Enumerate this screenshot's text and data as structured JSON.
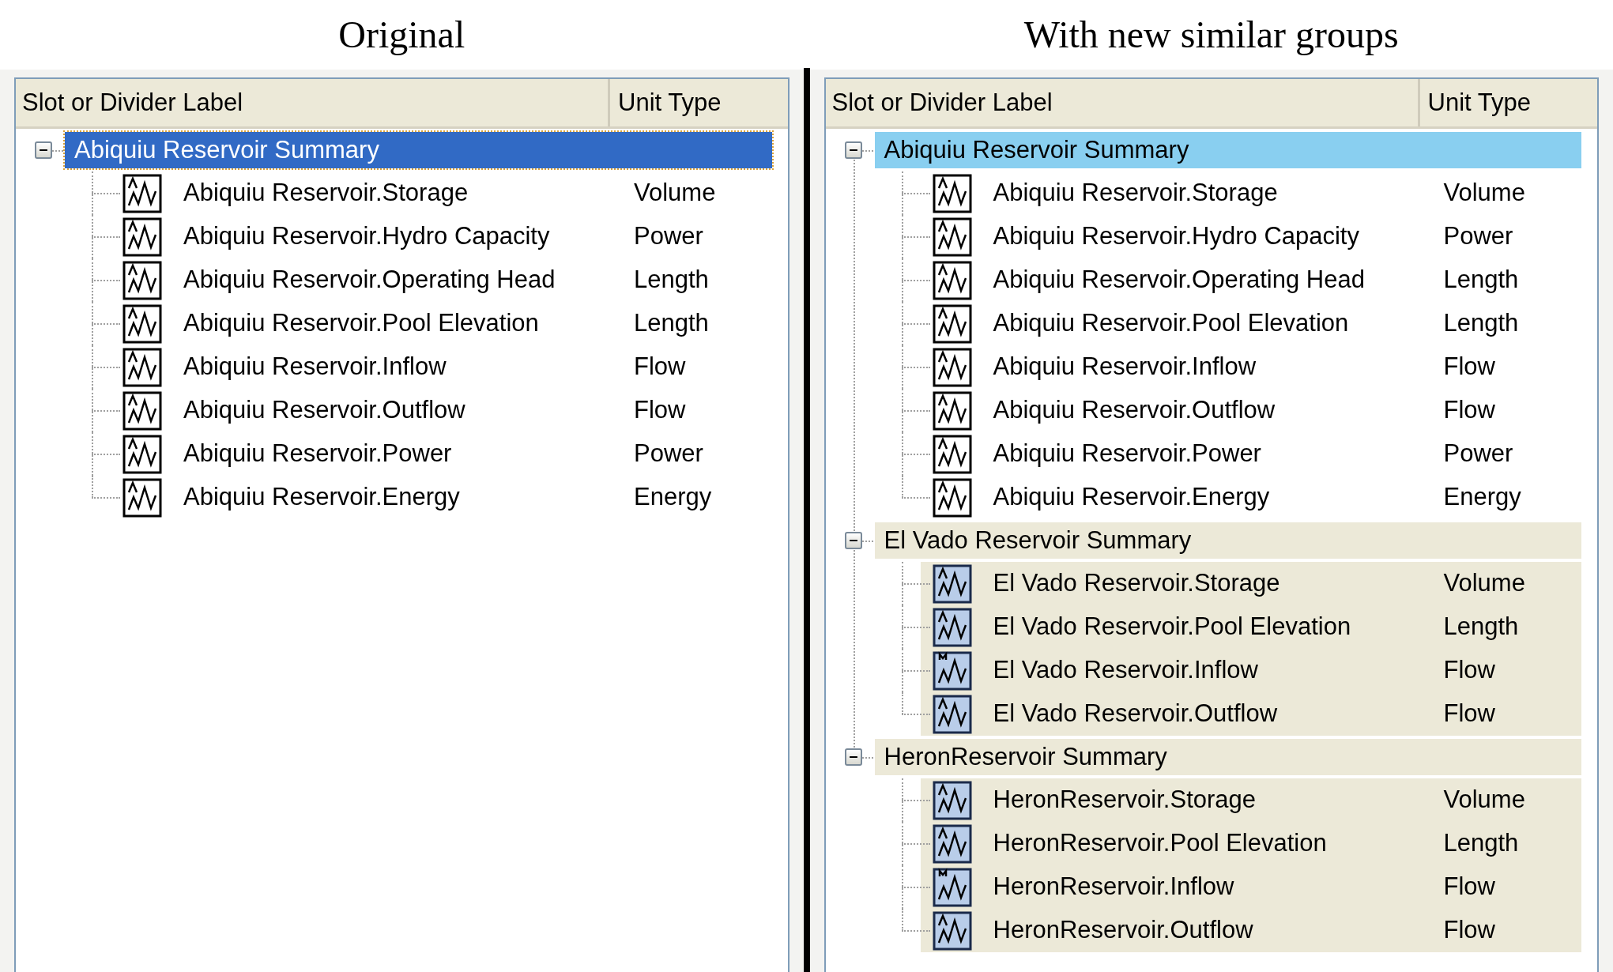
{
  "panels": [
    {
      "caption": "Original",
      "columns": [
        "Slot or Divider Label",
        "Unit Type"
      ],
      "groups": [
        {
          "label": "Abiquiu Reservoir Summary",
          "kind": "selected",
          "expanded": true,
          "children": [
            {
              "label": "Abiquiu Reservoir.Storage",
              "unit": "Volume"
            },
            {
              "label": "Abiquiu Reservoir.Hydro Capacity",
              "unit": "Power"
            },
            {
              "label": "Abiquiu Reservoir.Operating Head",
              "unit": "Length"
            },
            {
              "label": "Abiquiu Reservoir.Pool Elevation",
              "unit": "Length"
            },
            {
              "label": "Abiquiu Reservoir.Inflow",
              "unit": "Flow"
            },
            {
              "label": "Abiquiu Reservoir.Outflow",
              "unit": "Flow"
            },
            {
              "label": "Abiquiu Reservoir.Power",
              "unit": "Power"
            },
            {
              "label": "Abiquiu Reservoir.Energy",
              "unit": "Energy"
            }
          ]
        }
      ]
    },
    {
      "caption": "With new similar groups",
      "columns": [
        "Slot or Divider Label",
        "Unit Type"
      ],
      "groups": [
        {
          "label": "Abiquiu Reservoir Summary",
          "kind": "highlighted",
          "expanded": true,
          "children": [
            {
              "label": "Abiquiu Reservoir.Storage",
              "unit": "Volume"
            },
            {
              "label": "Abiquiu Reservoir.Hydro Capacity",
              "unit": "Power"
            },
            {
              "label": "Abiquiu Reservoir.Operating Head",
              "unit": "Length"
            },
            {
              "label": "Abiquiu Reservoir.Pool Elevation",
              "unit": "Length"
            },
            {
              "label": "Abiquiu Reservoir.Inflow",
              "unit": "Flow"
            },
            {
              "label": "Abiquiu Reservoir.Outflow",
              "unit": "Flow"
            },
            {
              "label": "Abiquiu Reservoir.Power",
              "unit": "Power"
            },
            {
              "label": "Abiquiu Reservoir.Energy",
              "unit": "Energy"
            }
          ]
        },
        {
          "label": "El Vado Reservoir Summary",
          "kind": "similar",
          "expanded": true,
          "children": [
            {
              "label": "El Vado Reservoir.Storage",
              "unit": "Volume"
            },
            {
              "label": "El Vado Reservoir.Pool Elevation",
              "unit": "Length"
            },
            {
              "label": "El Vado Reservoir.Inflow",
              "unit": "Flow"
            },
            {
              "label": "El Vado Reservoir.Outflow",
              "unit": "Flow"
            }
          ]
        },
        {
          "label": "HeronReservoir Summary",
          "kind": "similar",
          "expanded": true,
          "children": [
            {
              "label": "HeronReservoir.Storage",
              "unit": "Volume"
            },
            {
              "label": "HeronReservoir.Pool Elevation",
              "unit": "Length"
            },
            {
              "label": "HeronReservoir.Inflow",
              "unit": "Flow"
            },
            {
              "label": "HeronReservoir.Outflow",
              "unit": "Flow"
            }
          ]
        }
      ]
    }
  ]
}
